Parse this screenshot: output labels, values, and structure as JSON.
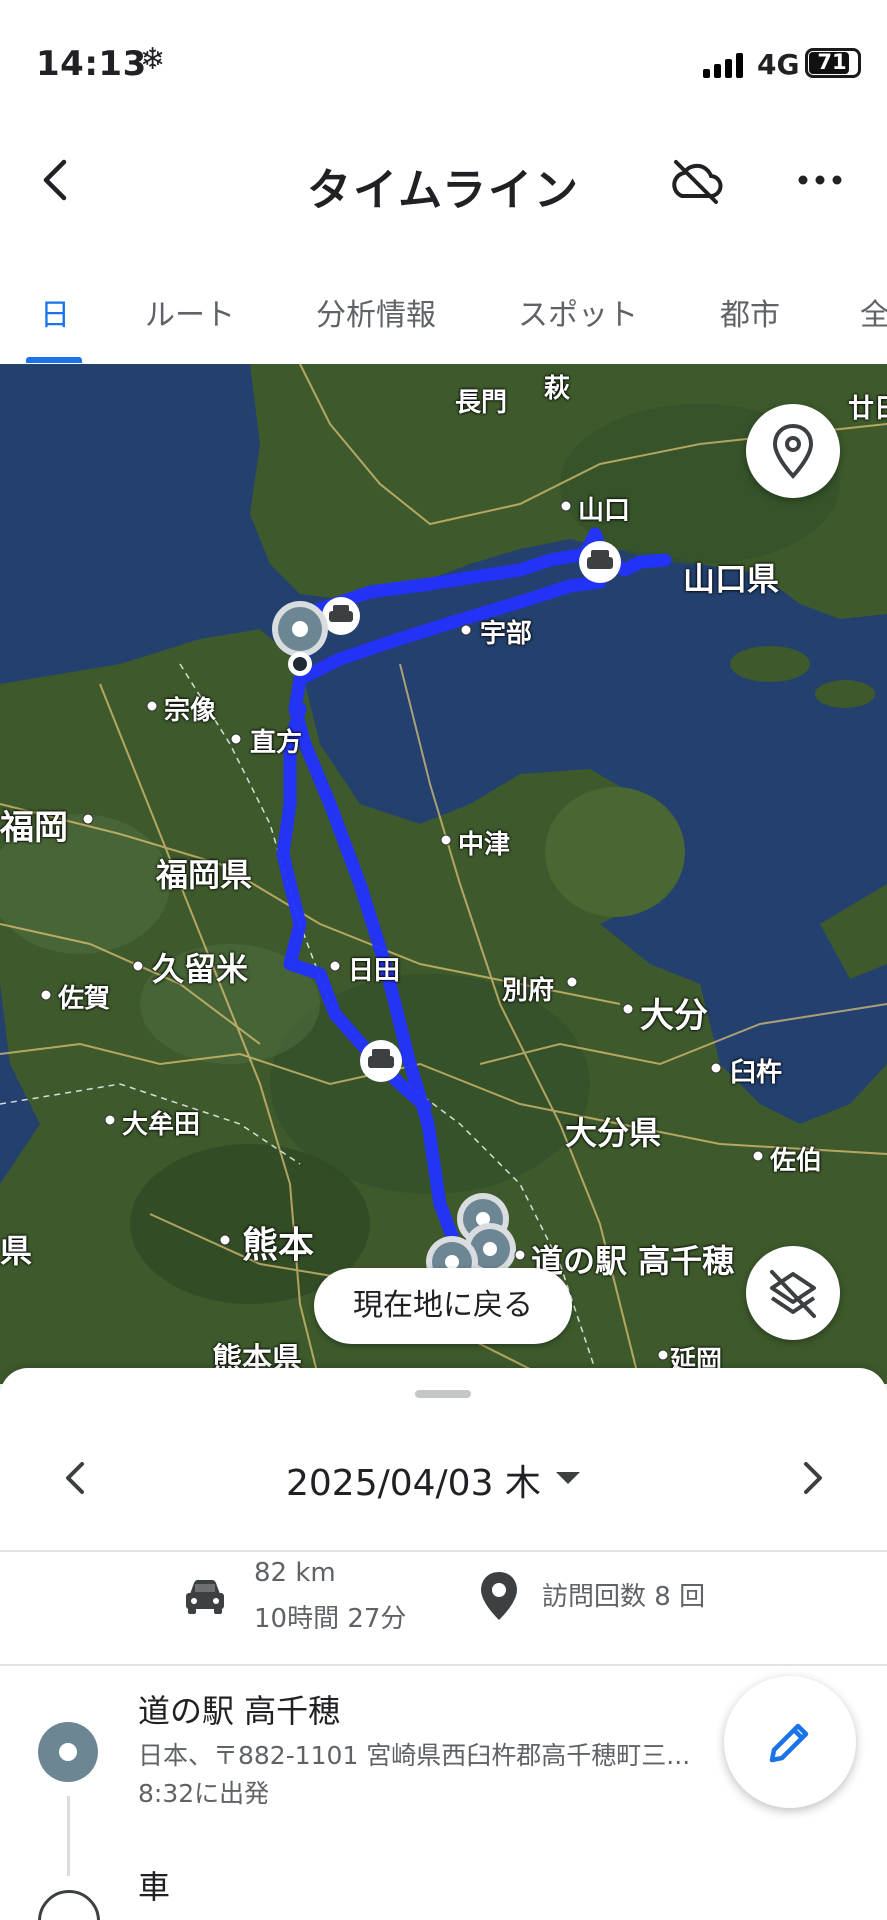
{
  "status_bar": {
    "time": "14:13",
    "network": "4G",
    "battery": "71"
  },
  "header": {
    "title": "タイムライン"
  },
  "tabs": [
    {
      "label": "日",
      "active": true
    },
    {
      "label": "ルート"
    },
    {
      "label": "分析情報"
    },
    {
      "label": "スポット"
    },
    {
      "label": "都市"
    },
    {
      "label": "全"
    }
  ],
  "map": {
    "labels": {
      "hagi": "萩",
      "nagato": "長門",
      "yamaguchi": "山口",
      "yamaguchi_pref": "山口県",
      "ube": "宇部",
      "munakata": "宗像",
      "nogata": "直方",
      "fukuoka": "福岡",
      "fukuoka_pref": "福岡県",
      "nakatsu": "中津",
      "kurume": "久留米",
      "hita": "日田",
      "beppu": "別府",
      "oita": "大分",
      "saga": "佐賀",
      "usuki": "臼杵",
      "omuta": "大牟田",
      "oita_pref": "大分県",
      "saiki": "佐伯",
      "kumamoto": "熊本",
      "kumamoto_pref": "熊本県",
      "michinoeki": "道の駅 高千穂",
      "nobeoka": "延岡",
      "hatsukaichi": "廿日",
      "edge_ken": "県"
    },
    "back_to_location": "現在地に戻る",
    "icons": {
      "place_button": "location-pin-icon",
      "layers_button": "layers-off-icon"
    },
    "colors": {
      "route": "#2233ff",
      "land": "#3e5a2c",
      "sea": "#23406e"
    }
  },
  "sheet": {
    "date": "2025/04/03 木",
    "summary": {
      "distance": "82 km",
      "duration": "10時間 27分",
      "visits": "訪問回数 8 回"
    },
    "place": {
      "name": "道の駅 高千穂",
      "address": "日本、〒882-1101 宮崎県西臼杵郡高千穂町三...",
      "departure": "8:32に出発"
    },
    "next": {
      "name": "車"
    }
  }
}
